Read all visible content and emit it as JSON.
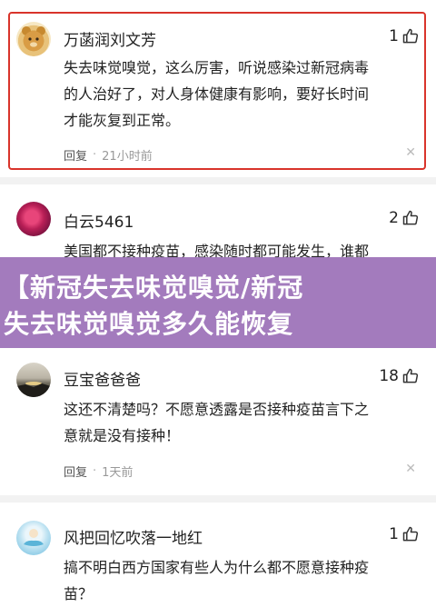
{
  "comments": [
    {
      "username": "万菡润刘文芳",
      "likes": "1",
      "text_lines": [
        "失去味觉嗅觉，这么厉害，听说感染过新冠病毒",
        "的人治好了，对人身体健康有影响，要好长时间",
        "才能灰复到正常。"
      ],
      "reply": "回复",
      "time": "21小时前"
    },
    {
      "username": "白云5461",
      "likes": "2",
      "text_lines": [
        "美国都不接种疫苗，感染随时都可能发生，谁都"
      ]
    },
    {
      "username": "豆宝爸爸爸",
      "likes": "18",
      "text_lines": [
        "这还不清楚吗？不愿意透露是否接种疫苗言下之",
        "意就是没有接种！"
      ],
      "reply": "回复",
      "time": "1天前"
    },
    {
      "username": "风把回忆吹落一地红",
      "likes": "1",
      "text_lines": [
        "搞不明白西方国家有些人为什么都不愿意接种疫",
        "苗？"
      ]
    }
  ],
  "banner": {
    "line1": "【新冠失去味觉嗅觉/新冠",
    "line2": "失去味觉嗅觉多久能恢复"
  },
  "icons": {
    "like": "thumbs-up-icon",
    "close": "close-icon"
  },
  "colors": {
    "highlight_border": "#d9342b",
    "banner_bg": "#9669b4"
  }
}
